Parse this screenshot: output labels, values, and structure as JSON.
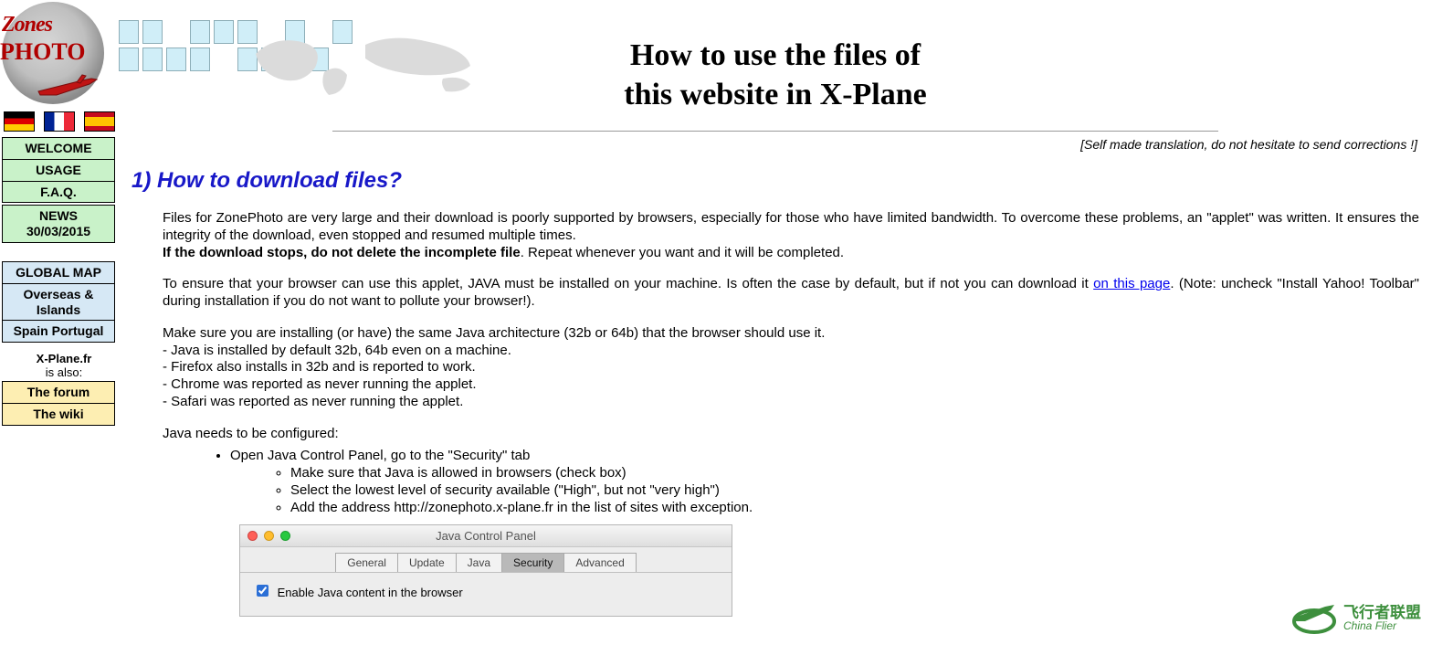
{
  "logo": {
    "line1": "Zones",
    "line2": "PHOTO"
  },
  "flags": {
    "de": "German",
    "fr": "French",
    "es": "Spanish"
  },
  "nav": {
    "main": [
      "WELCOME",
      "USAGE",
      "F.A.Q."
    ],
    "news_label": "NEWS",
    "news_date": "30/03/2015",
    "secondary": [
      "GLOBAL MAP",
      "Overseas & Islands",
      "Spain Portugal"
    ],
    "also_label_1": "X-Plane.fr",
    "also_label_2": "is also:",
    "tertiary": [
      "The forum",
      "The wiki"
    ]
  },
  "title_line1": "How to use the files of",
  "title_line2": "this website in X-Plane",
  "note_right": "[Self made translation, do not hesitate to send corrections !]",
  "section1": {
    "heading": "1) How to download files?",
    "p1": "Files for ZonePhoto are very large and their download is poorly supported by browsers, especially for those who have limited bandwidth. To overcome these problems, an \"applet\" was written. It ensures the integrity of the download, even stopped and resumed multiple times.",
    "p1b_strong": "If the download stops, do not delete the incomplete file",
    "p1b_rest": ". Repeat whenever you want and it will be completed.",
    "p2a": "To ensure that your browser can use this applet, JAVA must be installed on your machine. Is often the case by default, but if not you can download it ",
    "p2_link": "on this page",
    "p2b": ". (Note: uncheck \"Install Yahoo! Toolbar\" during installation if you do not want to pollute your browser!).",
    "p3_intro": "Make sure you are installing (or have) the same Java architecture (32b or 64b) that the browser should use it.",
    "p3_lines": [
      "- Java is installed by default 32b, 64b even on a machine.",
      "- Firefox also installs in 32b and is reported to work.",
      "- Chrome was reported as never running the applet.",
      "- Safari was reported as never running the applet."
    ],
    "p4": "Java needs to be configured:",
    "config_top": "Open Java Control Panel, go to the \"Security\" tab",
    "config_sub": [
      "Make sure that Java is allowed in browsers (check box)",
      "Select the lowest level of security available (\"High\", but not \"very high\")",
      "Add the address http://zonephoto.x-plane.fr in the list of sites with exception."
    ]
  },
  "java_panel": {
    "title": "Java Control Panel",
    "tabs": [
      "General",
      "Update",
      "Java",
      "Security",
      "Advanced"
    ],
    "active_tab": "Security",
    "checkbox_label": "Enable Java content in the browser"
  },
  "brand": {
    "cn": "飞行者联盟",
    "en": "China Flier"
  }
}
